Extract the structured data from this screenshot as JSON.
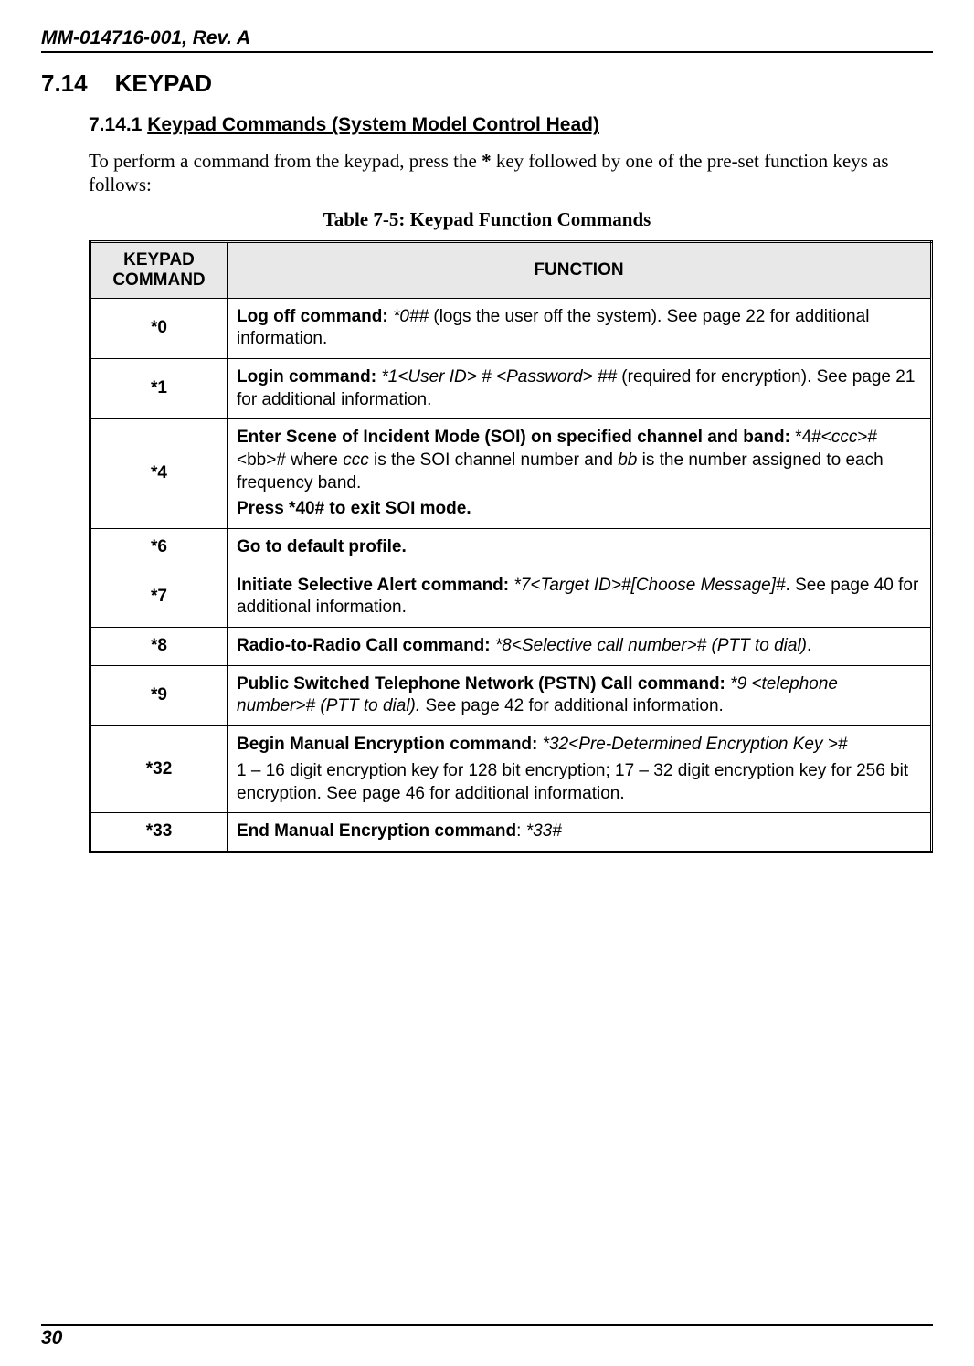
{
  "header": {
    "doc_id": "MM-014716-001, Rev. A"
  },
  "section": {
    "number": "7.14",
    "title": "KEYPAD"
  },
  "subsection": {
    "number": "7.14.1",
    "title": "Keypad Commands (System Model Control Head)"
  },
  "paragraph": {
    "pre": "To perform a command from the keypad, press the ",
    "key": "*",
    "post": " key followed by one of the pre-set function keys as follows:"
  },
  "table_caption": "Table 7-5: Keypad Function Commands",
  "table": {
    "headers": {
      "col1": "KEYPAD COMMAND",
      "col2": "FUNCTION"
    },
    "rows": [
      {
        "cmd": "*0",
        "b1": "Log off command:  ",
        "i1": "*0##",
        "t1": " (logs the user off the system). See page 22 for additional information."
      },
      {
        "cmd": "*1",
        "b1": "Login command:  ",
        "i1": "*1<User ID> # <Password> ##",
        "t1": " (required for encryption). See page 21 for additional information."
      },
      {
        "cmd": "*4",
        "b1": "Enter Scene of Incident Mode (SOI) on specified channel and band: ",
        "t1a": "*4#<",
        "i1a": "ccc",
        "t1b": ">#<bb># where ",
        "i1b": "ccc",
        "t1c": " is the SOI channel number and ",
        "i1c": "bb",
        "t1d": " is the number assigned to each frequency band.",
        "b2": "Press *40# to exit SOI mode."
      },
      {
        "cmd": "*6",
        "b1": "Go to default profile."
      },
      {
        "cmd": "*7",
        "b1": "Initiate Selective Alert command:  ",
        "i1": "*7<Target ID>#[Choose Message]#",
        "t1": ". See page 40 for additional information."
      },
      {
        "cmd": "*8",
        "b1": "Radio-to-Radio Call command: ",
        "i1": "*8<Selective call number># (PTT to dial)",
        "t1": "."
      },
      {
        "cmd": "*9",
        "b1": "Public Switched Telephone Network (PSTN) Call command:  ",
        "i1": "*9 <telephone number># (PTT to dial).",
        "t1": " See page 42 for additional information."
      },
      {
        "cmd": "*32",
        "b1": "Begin Manual Encryption command:  ",
        "i1": "*32<Pre-Determined Encryption Key >#",
        "t2": "1 – 16 digit encryption key for 128 bit encryption; 17 – 32 digit encryption key for 256 bit encryption. See page 46 for additional information."
      },
      {
        "cmd": "*33",
        "b1": "End Manual Encryption command",
        "t1": ": ",
        "i1": "*33#"
      }
    ]
  },
  "footer": {
    "page": "30"
  }
}
